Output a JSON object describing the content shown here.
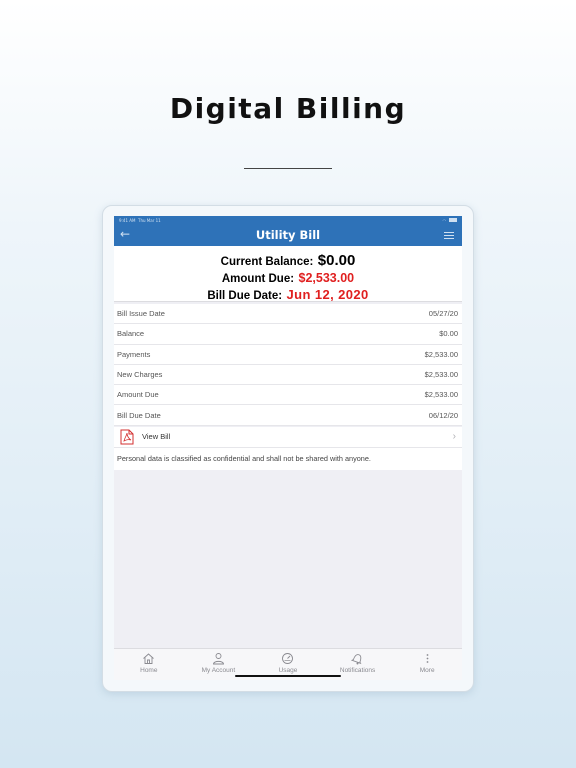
{
  "headline": "Digital Billing",
  "statusbar": {
    "time": "9:41 AM",
    "date": "Thu Mar 11"
  },
  "navbar": {
    "title": "Utility Bill"
  },
  "summary": {
    "current_balance_label": "Current Balance:",
    "current_balance_value": "$0.00",
    "amount_due_label": "Amount Due:",
    "amount_due_value": "$2,533.00",
    "due_date_label": "Bill Due Date:",
    "due_date_value": "Jun 12, 2020"
  },
  "rows": [
    {
      "label": "Bill Issue Date",
      "value": "05/27/20"
    },
    {
      "label": "Balance",
      "value": "$0.00"
    },
    {
      "label": "Payments",
      "value": "$2,533.00"
    },
    {
      "label": "New Charges",
      "value": "$2,533.00"
    },
    {
      "label": "Amount Due",
      "value": "$2,533.00"
    },
    {
      "label": "Bill Due Date",
      "value": "06/12/20"
    }
  ],
  "view_bill": {
    "label": "View Bill"
  },
  "notice": "Personal data is classified as confidential and shall not be shared with anyone.",
  "tabs": [
    {
      "label": "Home",
      "icon": "home-icon"
    },
    {
      "label": "My Account",
      "icon": "user-icon"
    },
    {
      "label": "Usage",
      "icon": "gauge-icon"
    },
    {
      "label": "Notifications",
      "icon": "bell-icon"
    },
    {
      "label": "More",
      "icon": "more-icon"
    }
  ],
  "colors": {
    "brand": "#2e72b8",
    "alert": "#e02020"
  }
}
